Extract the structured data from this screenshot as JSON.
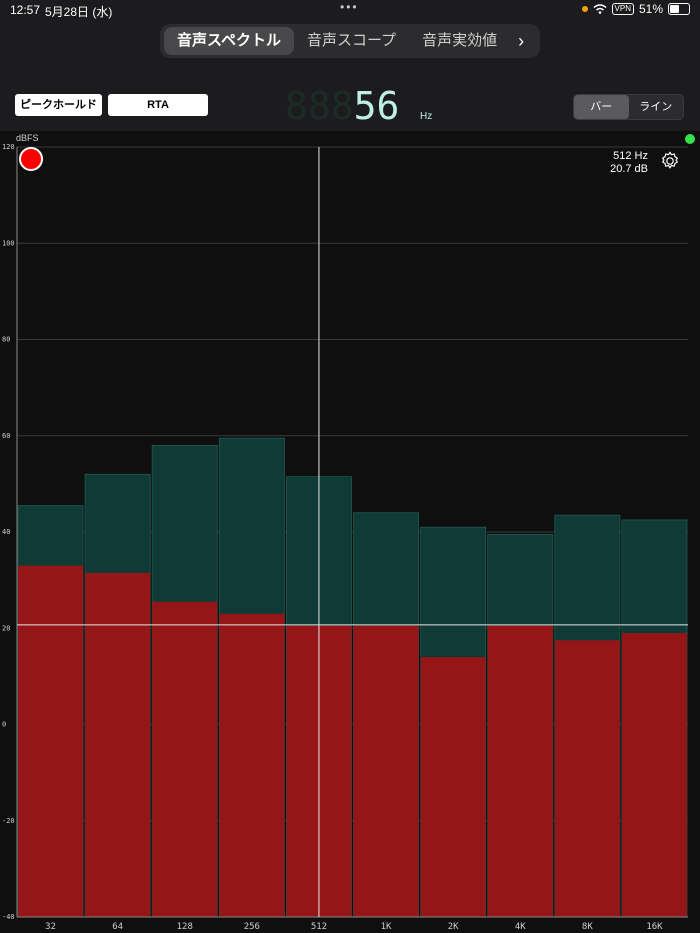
{
  "status_bar": {
    "time": "12:57",
    "date": "5月28日 (水)",
    "vpn": "VPN",
    "battery": "51%"
  },
  "tabs": {
    "items": [
      "音声スペクトル",
      "音声スコープ",
      "音声実効値"
    ],
    "active_index": 0,
    "next": "›"
  },
  "controls": {
    "peak_hold_label": "ピークホールド",
    "rta_label": "RTA",
    "freq_ghost": "888",
    "freq_value": "56",
    "freq_unit": "Hz",
    "mode_bar": "バー",
    "mode_line": "ライン"
  },
  "readout": {
    "freq": "512 Hz",
    "level": "20.7 dB"
  },
  "colors": {
    "bar_current": "#951616",
    "bar_peak": "#103a36",
    "record": "#ff0000",
    "indicator": "#35e04a"
  },
  "chart_data": {
    "type": "bar",
    "ylabel": "dBFS",
    "ylim": [
      -40,
      120
    ],
    "yticks": [
      120,
      100,
      80,
      60,
      40,
      20,
      0,
      -20,
      -40
    ],
    "categories": [
      "32",
      "64",
      "128",
      "256",
      "512",
      "1K",
      "2K",
      "4K",
      "8K",
      "16K"
    ],
    "series": [
      {
        "values": [
          33,
          31.5,
          25.5,
          23,
          20.5,
          20.5,
          14,
          20.5,
          17.5,
          19
        ]
      },
      {
        "values": [
          45.5,
          52,
          58,
          59.5,
          51.5,
          44,
          41,
          39.5,
          43.5,
          42.5
        ]
      }
    ],
    "cursor": {
      "x": "512",
      "y": 20.7
    },
    "grid": true
  }
}
